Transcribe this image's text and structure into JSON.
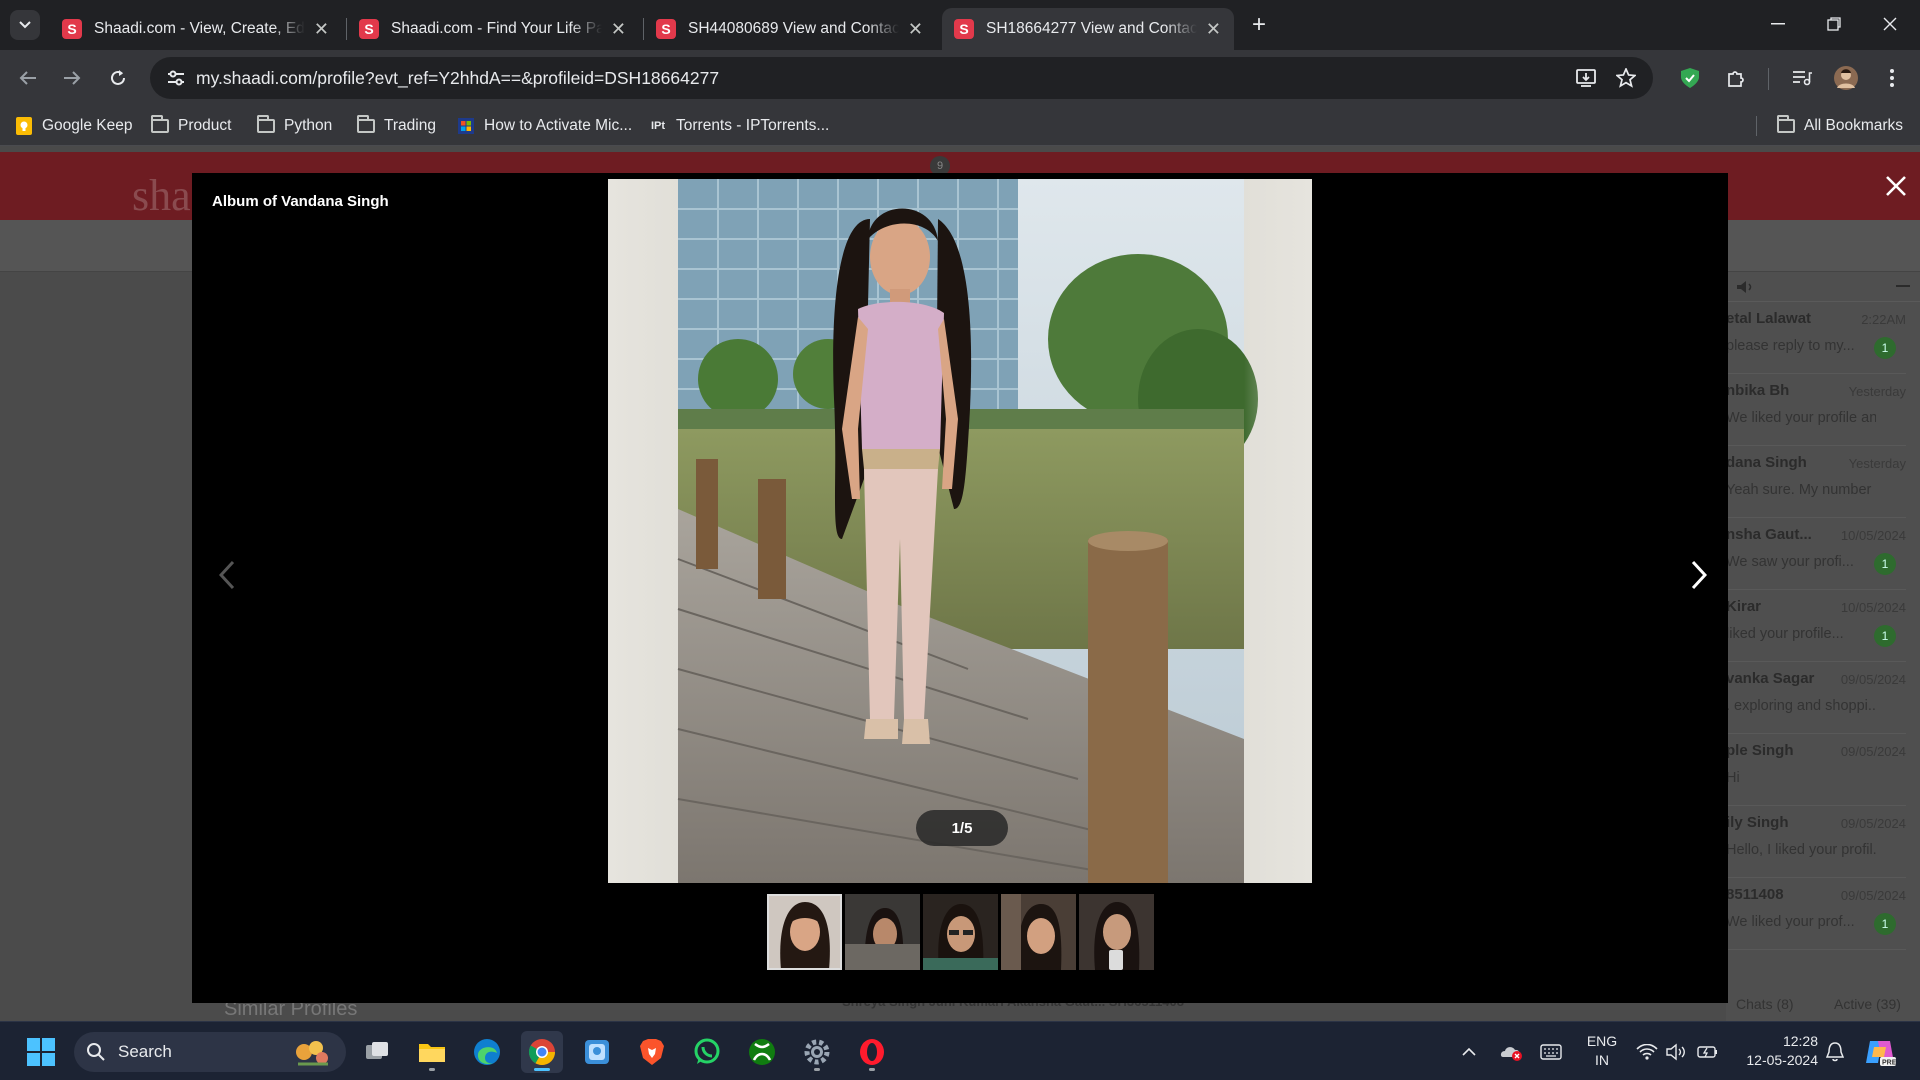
{
  "tabs": [
    {
      "title": "Shaadi.com - View, Create, Edit,",
      "favicon": "S"
    },
    {
      "title": "Shaadi.com - Find Your Life Part",
      "favicon": "S"
    },
    {
      "title": "SH44080689 View and Contact",
      "favicon": "S"
    },
    {
      "title": "SH18664277 View and Contact",
      "favicon": "S",
      "active": true
    }
  ],
  "address_bar": {
    "url": "my.shaadi.com/profile?evt_ref=Y2hhdA==&profileid=DSH18664277"
  },
  "bookmarks": [
    {
      "label": "Google Keep",
      "icon": "google-keep-icon"
    },
    {
      "label": "Product",
      "icon": "folder-icon"
    },
    {
      "label": "Python",
      "icon": "folder-icon"
    },
    {
      "label": "Trading",
      "icon": "folder-icon"
    },
    {
      "label": "How to Activate Mic...",
      "icon": "windows-icon"
    },
    {
      "label": "Torrents - IPTorrents...",
      "icon": "iptorrents-icon"
    }
  ],
  "all_bookmarks_label": "All Bookmarks",
  "page": {
    "logo_text": "sha",
    "similar_profiles": "Similar Profiles",
    "bottom_names": "Shreya Singh          Juhi Kumari          Akansha Gaut...          SH36511408"
  },
  "chat": {
    "items": [
      {
        "name": "etal Lalawat",
        "time": "2:22AM",
        "msg": "please reply to my...",
        "badge": "1"
      },
      {
        "name": "nbika Bh",
        "time": "Yesterday",
        "msg": "We liked your profile an...",
        "badge": ""
      },
      {
        "name": "dana Singh",
        "time": "Yesterday",
        "msg": "Yeah sure. My number i...",
        "badge": ""
      },
      {
        "name": "nsha Gaut...",
        "time": "10/05/2024",
        "msg": "We saw your profi...",
        "badge": "1"
      },
      {
        "name": "Kirar",
        "time": "10/05/2024",
        "msg": "liked your profile...",
        "badge": "1"
      },
      {
        "name": "vanka Sagar",
        "time": "09/05/2024",
        "msg": ". exploring and shoppi...",
        "badge": ""
      },
      {
        "name": "ple Singh",
        "time": "09/05/2024",
        "msg": "Hi",
        "badge": ""
      },
      {
        "name": "ily Singh",
        "time": "09/05/2024",
        "msg": "Hello, I liked your profil...",
        "badge": ""
      },
      {
        "name": "8511408",
        "time": "09/05/2024",
        "msg": "We liked your prof...",
        "badge": "1"
      }
    ],
    "chats_count": "Chats (8)",
    "active_count": "Active (39)"
  },
  "lightbox": {
    "album_title": "Album of Vandana Singh",
    "counter": "1/5",
    "thumbnail_count": 5,
    "selected_index": 0
  },
  "taskbar": {
    "search_label": "Search",
    "lang_line1": "ENG",
    "lang_line2": "IN",
    "time": "12:28",
    "date": "12-05-2024"
  }
}
